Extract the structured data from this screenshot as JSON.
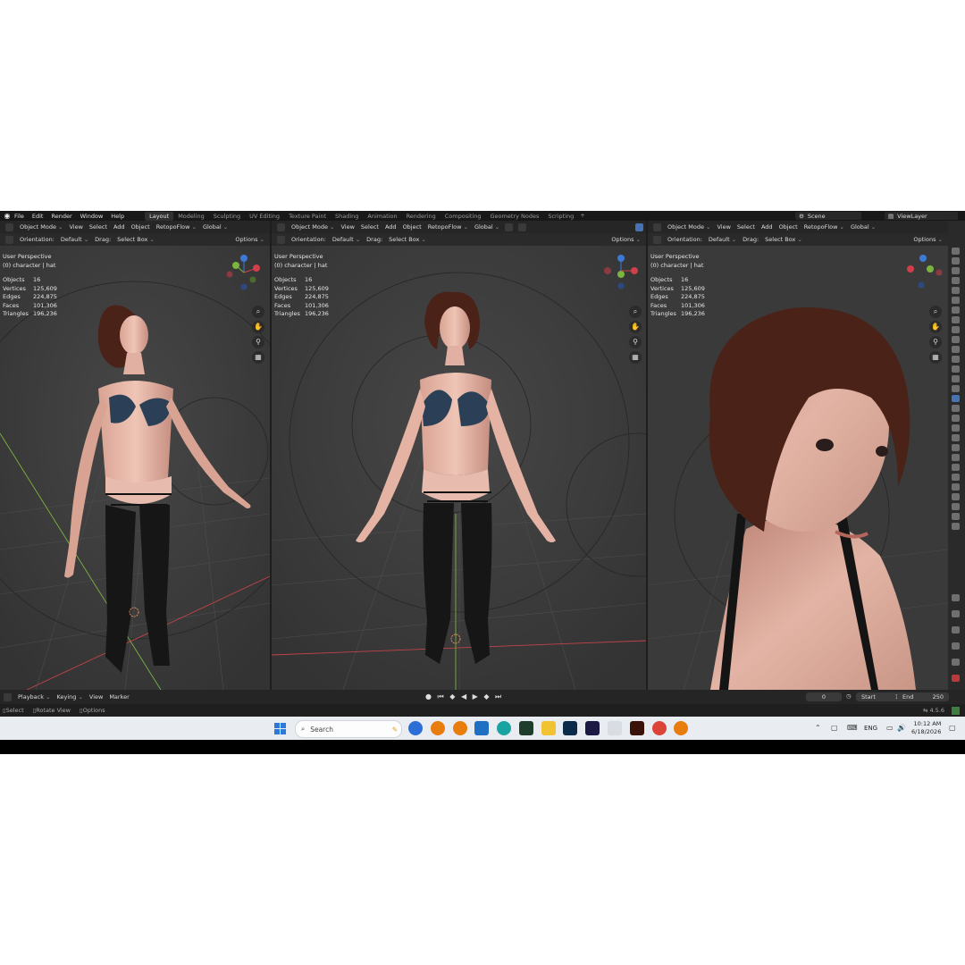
{
  "menu": [
    "File",
    "Edit",
    "Render",
    "Window",
    "Help"
  ],
  "workspace_tabs": [
    "Layout",
    "Modeling",
    "Sculpting",
    "UV Editing",
    "Texture Paint",
    "Shading",
    "Animation",
    "Rendering",
    "Compositing",
    "Geometry Nodes",
    "Scripting"
  ],
  "active_tab": "Layout",
  "scene": {
    "label": "Scene",
    "view_layer": "ViewLayer"
  },
  "viewport_header": {
    "mode": "Object Mode",
    "menus": [
      "View",
      "Select",
      "Add",
      "Object"
    ],
    "addon": "RetopoFlow",
    "transform": "Global"
  },
  "tool_header": {
    "orientation_label": "Orientation:",
    "orientation_value": "Default",
    "drag_label": "Drag:",
    "drag_value": "Select Box",
    "options": "Options"
  },
  "overlay": {
    "perspective": "User Perspective",
    "collection": "(0) character | hat",
    "stats": [
      {
        "label": "Objects",
        "value": "16"
      },
      {
        "label": "Vertices",
        "value": "125,609"
      },
      {
        "label": "Edges",
        "value": "224,875"
      },
      {
        "label": "Faces",
        "value": "101,306"
      },
      {
        "label": "Triangles",
        "value": "196,236"
      }
    ]
  },
  "timeline": {
    "menus": [
      "Playback",
      "Keying",
      "View",
      "Marker"
    ],
    "current_frame": "0",
    "start_label": "Start",
    "start": "1",
    "end_label": "End",
    "end": "250"
  },
  "statusbar": {
    "hints": [
      "Select",
      "Rotate View",
      "Options"
    ],
    "version": "4.5.6"
  },
  "taskbar": {
    "search_placeholder": "Search",
    "lang": "ENG",
    "time": "10:12 AM",
    "date": "6/18/2026"
  },
  "colors": {
    "accent": "#4772b3",
    "skin": "#e8b7a6",
    "hair": "#4a2218",
    "bikini": "#2b3f57",
    "stockings": "#161616",
    "x_axis": "#d0404a",
    "y_axis": "#7bb53f",
    "z_axis": "#3d79d6"
  }
}
